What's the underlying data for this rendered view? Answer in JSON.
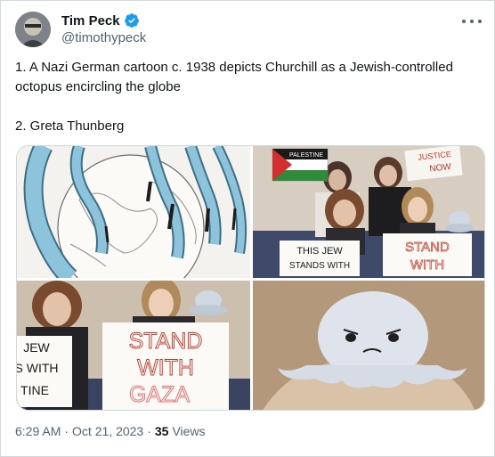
{
  "author": {
    "name": "Tim Peck",
    "handle": "@timothypeck",
    "verified": true
  },
  "tweet": {
    "line1": "1. A Nazi German cartoon c. 1938 depicts Churchill as a Jewish-controlled octopus encircling the globe",
    "line2": "2. Greta Thunberg"
  },
  "signs": {
    "flag_left": "PALESTINE",
    "justice_1": "JUSTICE",
    "justice_2": "NOW",
    "jew_1": "THIS JEW",
    "jew_2": "STANDS WITH",
    "stand_small_1": "STAND",
    "stand_small_2": "WITH",
    "left_sign_1": "JEW",
    "left_sign_2": "S WITH",
    "left_sign_3": "TINE",
    "big_1": "STAND",
    "big_2": "WITH",
    "big_3": "GAZA"
  },
  "footer": {
    "time": "6:29 AM",
    "date": "Oct 21, 2023",
    "views_count": "35",
    "views_label": "Views"
  },
  "colors": {
    "verified": "#1d9bf0",
    "text_primary": "#0f1419",
    "text_secondary": "#536471",
    "border": "#cfd9de",
    "octopus_blue": "#8ec3dc",
    "gaza_red": "#d9534f"
  }
}
